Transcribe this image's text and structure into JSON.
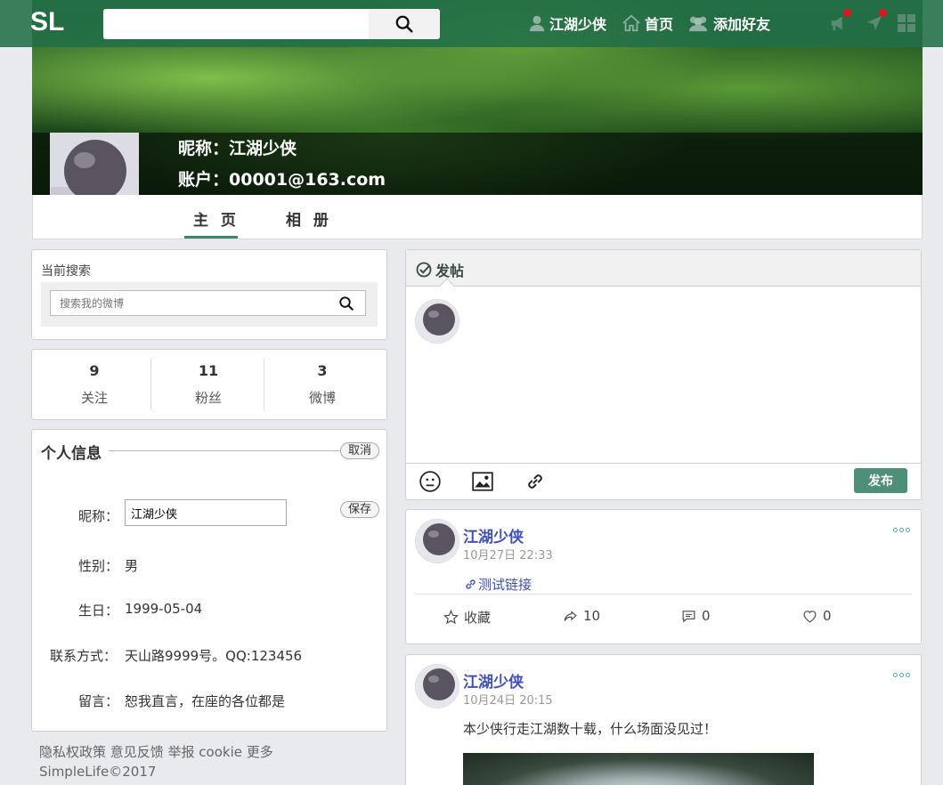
{
  "header": {
    "logo": "SL",
    "search_placeholder": "",
    "user_label": "江湖少侠",
    "home_label": "首页",
    "add_friend_label": "添加好友"
  },
  "profile": {
    "nickname_line": "昵称：江湖少侠",
    "account_line": "账户：00001@163.com",
    "tabs": [
      "主 页",
      "相 册"
    ]
  },
  "sidebar": {
    "search_title": "当前搜索",
    "search_placeholder": "搜索我的微博",
    "stats": [
      {
        "num": "9",
        "label": "关注"
      },
      {
        "num": "11",
        "label": "粉丝"
      },
      {
        "num": "3",
        "label": "微博"
      }
    ],
    "info": {
      "title": "个人信息",
      "cancel_label": "取消",
      "save_label": "保存",
      "nickname_key": "昵称：",
      "nickname_value": "江湖少侠",
      "gender_key": "性别：",
      "gender_value": "男",
      "birthday_key": "生日：",
      "birthday_value": "1999-05-04",
      "contact_key": "联系方式：",
      "contact_value": "天山路9999号。QQ:123456",
      "message_key": "留言：",
      "message_value": "恕我直言，在座的各位都是"
    },
    "footer_links": "隐私权政策 意见反馈 举报 cookie 更多",
    "copyright": "SimpleLife©2017"
  },
  "composer": {
    "header_label": "发帖",
    "publish_label": "发布"
  },
  "posts": [
    {
      "author": "江湖少侠",
      "time": "10月27日 22:33",
      "link_text": "测试链接",
      "actions": {
        "favorite": "收藏",
        "share": "10",
        "comment": "0",
        "like": "0"
      }
    },
    {
      "author": "江湖少侠",
      "time": "10月24日 20:15",
      "body": "本少侠行走江湖数十载，什么场面没见过！"
    }
  ],
  "colors": {
    "nav_bg": "#226e48",
    "accent": "#4f8f78",
    "link": "#3f51b5",
    "notification_dot": "#e0151b"
  }
}
